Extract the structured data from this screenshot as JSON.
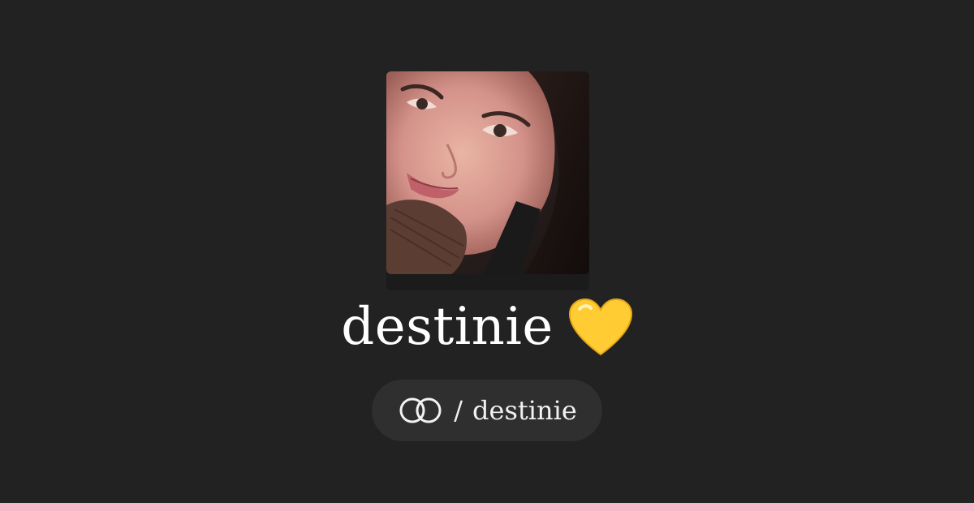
{
  "profile": {
    "name": "destinie",
    "handle_prefix": "/",
    "handle": "destinie",
    "avatar_icon": "profile-photo",
    "emoji_icon": "yellow-heart-icon",
    "link_icon": "linked-rings-icon"
  },
  "theme": {
    "background": "#222222",
    "pill_background": "#2f2f2f",
    "bottom_bar": "#f4b8cb",
    "heart": "#ffcc33",
    "text": "#ffffff"
  }
}
